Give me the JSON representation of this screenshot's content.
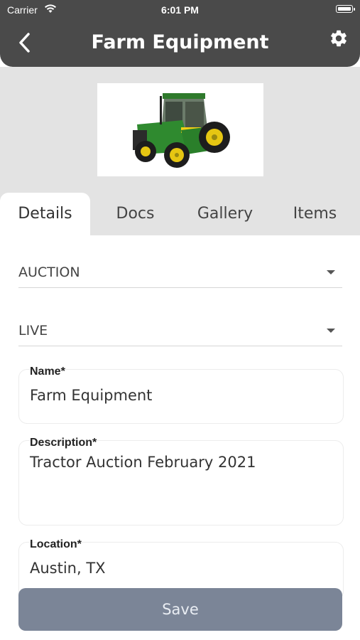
{
  "status_bar": {
    "carrier": "Carrier",
    "time": "6:01 PM"
  },
  "header": {
    "title": "Farm Equipment",
    "back_icon": "chevron-left-icon",
    "settings_icon": "gear-icon"
  },
  "hero": {
    "image_alt": "tractor-image"
  },
  "tabs": [
    {
      "label": "Details",
      "active": true
    },
    {
      "label": "Docs",
      "active": false
    },
    {
      "label": "Gallery",
      "active": false
    },
    {
      "label": "Items",
      "active": false
    }
  ],
  "form": {
    "type_select": {
      "value": "AUCTION"
    },
    "status_select": {
      "value": "LIVE"
    },
    "name": {
      "label": "Name*",
      "value": "Farm Equipment"
    },
    "description": {
      "label": "Description*",
      "value": "Tractor Auction February 2021"
    },
    "location": {
      "label": "Location*",
      "value": "Austin, TX"
    }
  },
  "save_label": "Save",
  "colors": {
    "header_bg": "#4a4a4a",
    "hero_bg": "#e3e3e3",
    "save_bg": "#7b8597"
  }
}
